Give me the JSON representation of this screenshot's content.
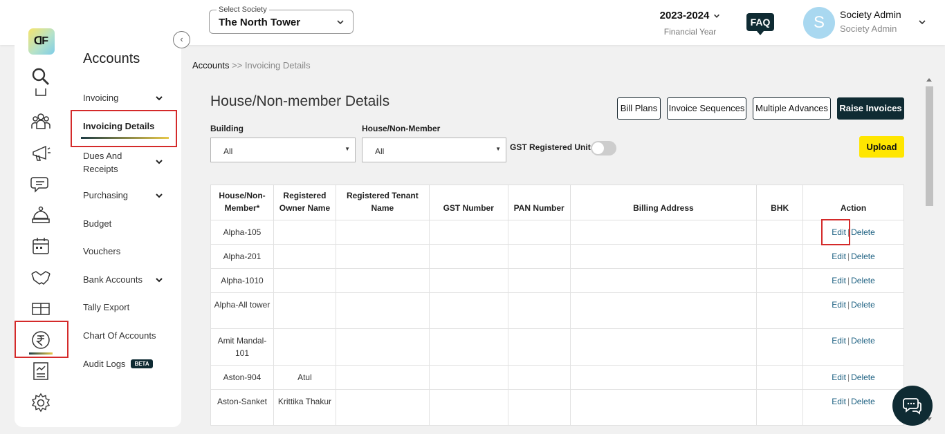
{
  "header": {
    "society_label": "Select Society",
    "society_value": "The North Tower",
    "financial_year": "2023-2024",
    "financial_year_label": "Financial Year",
    "faq": "FAQ",
    "avatar_initial": "S",
    "user_name": "Society Admin",
    "user_role": "Society Admin"
  },
  "logo_text": "ᗡF",
  "sidebar": {
    "title": "Accounts",
    "items": [
      {
        "label": "Invoicing"
      },
      {
        "label": "Invoicing Details"
      },
      {
        "label": "Dues And"
      },
      {
        "label": "Receipts"
      },
      {
        "label": "Purchasing"
      },
      {
        "label": "Budget"
      },
      {
        "label": "Vouchers"
      },
      {
        "label": "Bank Accounts"
      },
      {
        "label": "Tally Export"
      },
      {
        "label": "Chart Of Accounts"
      },
      {
        "label": "Audit Logs"
      }
    ],
    "beta": "BETA"
  },
  "breadcrumb": {
    "root": "Accounts",
    "separator": " >> ",
    "current": "Invoicing Details"
  },
  "page_title": "House/Non-member Details",
  "buttons": {
    "bill_plans": "Bill Plans",
    "invoice_sequences": "Invoice Sequences",
    "multiple_advances": "Multiple Advances",
    "raise_invoices": "Raise Invoices",
    "upload": "Upload"
  },
  "filters": {
    "building_label": "Building",
    "building_value": "All",
    "house_label": "House/Non-Member",
    "house_value": "All",
    "gst_toggle_label": "GST Registered Units"
  },
  "table": {
    "headers": [
      "House/Non-\nMember*",
      "Registered\nOwner Name",
      "Registered Tenant\nName",
      "GST Number",
      "PAN Number",
      "Billing Address",
      "BHK",
      "Action"
    ],
    "edit": "Edit",
    "delete": "Delete",
    "rows": [
      {
        "house": "Alpha-105",
        "owner": "",
        "tenant": ""
      },
      {
        "house": "Alpha-201",
        "owner": "",
        "tenant": ""
      },
      {
        "house": "Alpha-1010",
        "owner": "",
        "tenant": ""
      },
      {
        "house": "Alpha-All tower",
        "owner": "",
        "tenant": ""
      },
      {
        "house": "Amit Mandal-101",
        "owner": "",
        "tenant": ""
      },
      {
        "house": "Aston-904",
        "owner": "Atul",
        "tenant": ""
      },
      {
        "house": "Aston-Sanket",
        "owner": "Krittika Thakur",
        "tenant": ""
      }
    ]
  }
}
